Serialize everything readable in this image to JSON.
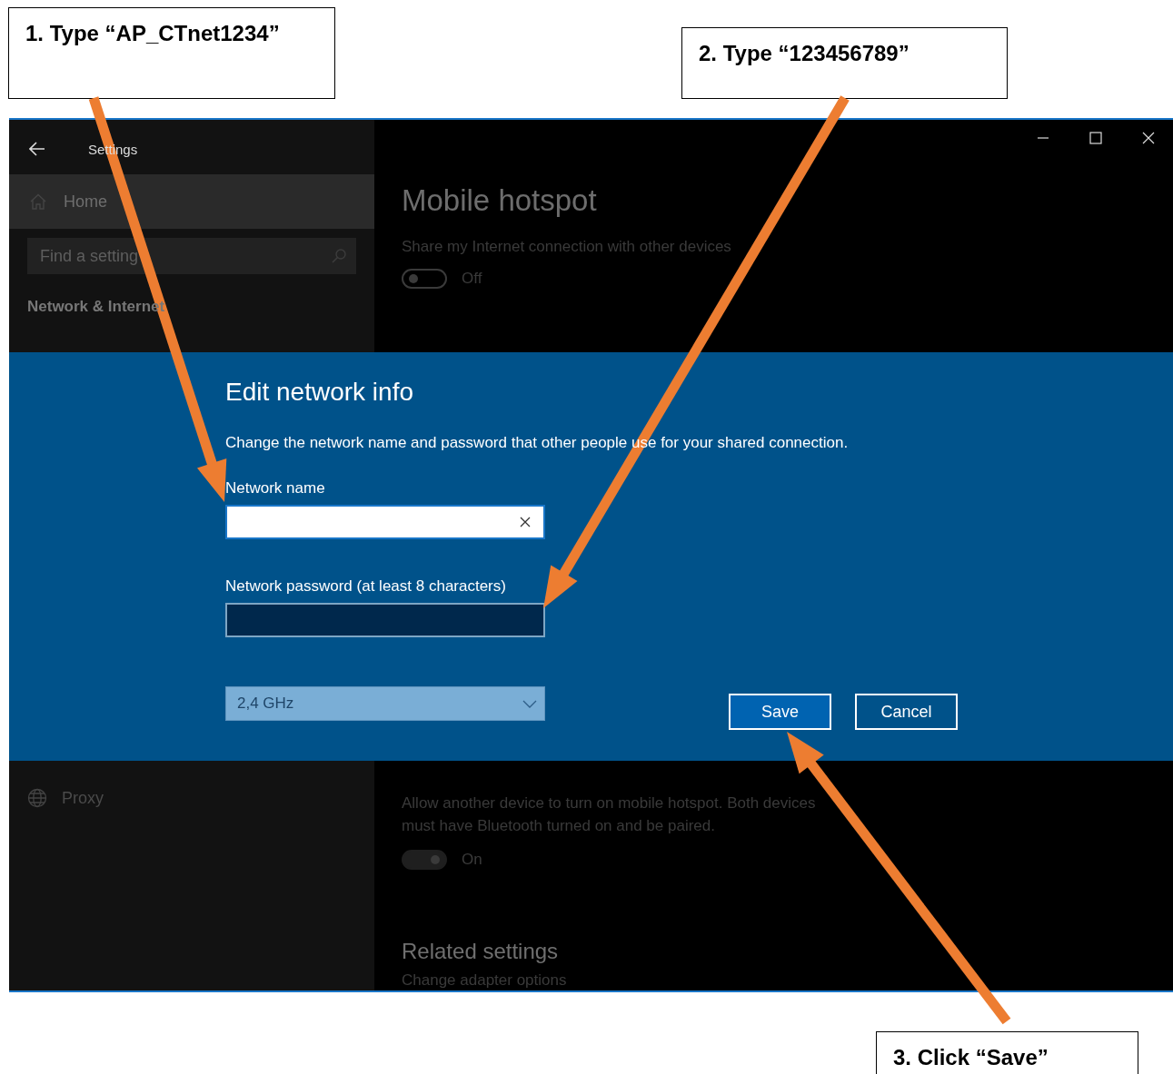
{
  "annotations": [
    {
      "text": "1. Type “AP_CTnet1234”"
    },
    {
      "text": "2. Type “123456789”"
    },
    {
      "text": "3. Click “Save”"
    }
  ],
  "window": {
    "title": "Settings"
  },
  "sidebar": {
    "home": "Home",
    "search": {
      "placeholder": "Find a setting"
    },
    "section": "Network & Internet",
    "items": [
      {
        "label": "Proxy"
      }
    ]
  },
  "main": {
    "title": "Mobile hotspot",
    "share_label": "Share my Internet connection with other devices",
    "share_toggle": {
      "on": false,
      "label": "Off"
    },
    "remote_description": "Allow another device to turn on mobile hotspot. Both devices must have Bluetooth turned on and be paired.",
    "remote_toggle": {
      "on": true,
      "label": "On"
    },
    "related_title": "Related settings",
    "related_link": "Change adapter options"
  },
  "dialog": {
    "title": "Edit network info",
    "description": "Change the network name and password that other people use for your shared connection.",
    "fields": [
      {
        "label": "Network name",
        "focused": true
      },
      {
        "label": "Network password (at least 8 characters)",
        "focused": false
      }
    ],
    "band": "2,4 GHz",
    "buttons": [
      {
        "label": "Save",
        "primary": true
      },
      {
        "label": "Cancel",
        "primary": false
      }
    ]
  }
}
